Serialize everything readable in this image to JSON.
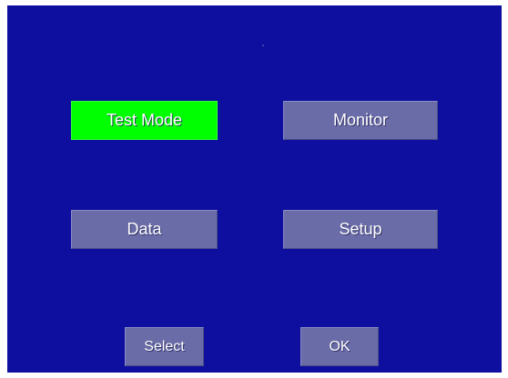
{
  "menu": {
    "items": [
      {
        "label": "Test Mode",
        "selected": true
      },
      {
        "label": "Monitor",
        "selected": false
      },
      {
        "label": "Data",
        "selected": false
      },
      {
        "label": "Setup",
        "selected": false
      }
    ]
  },
  "softkeys": {
    "select_label": "Select",
    "ok_label": "OK"
  },
  "colors": {
    "screen_background": "#0f0f9f",
    "button_normal": "#6a6ca8",
    "button_selected": "#00ff00",
    "text": "#ffffff"
  }
}
